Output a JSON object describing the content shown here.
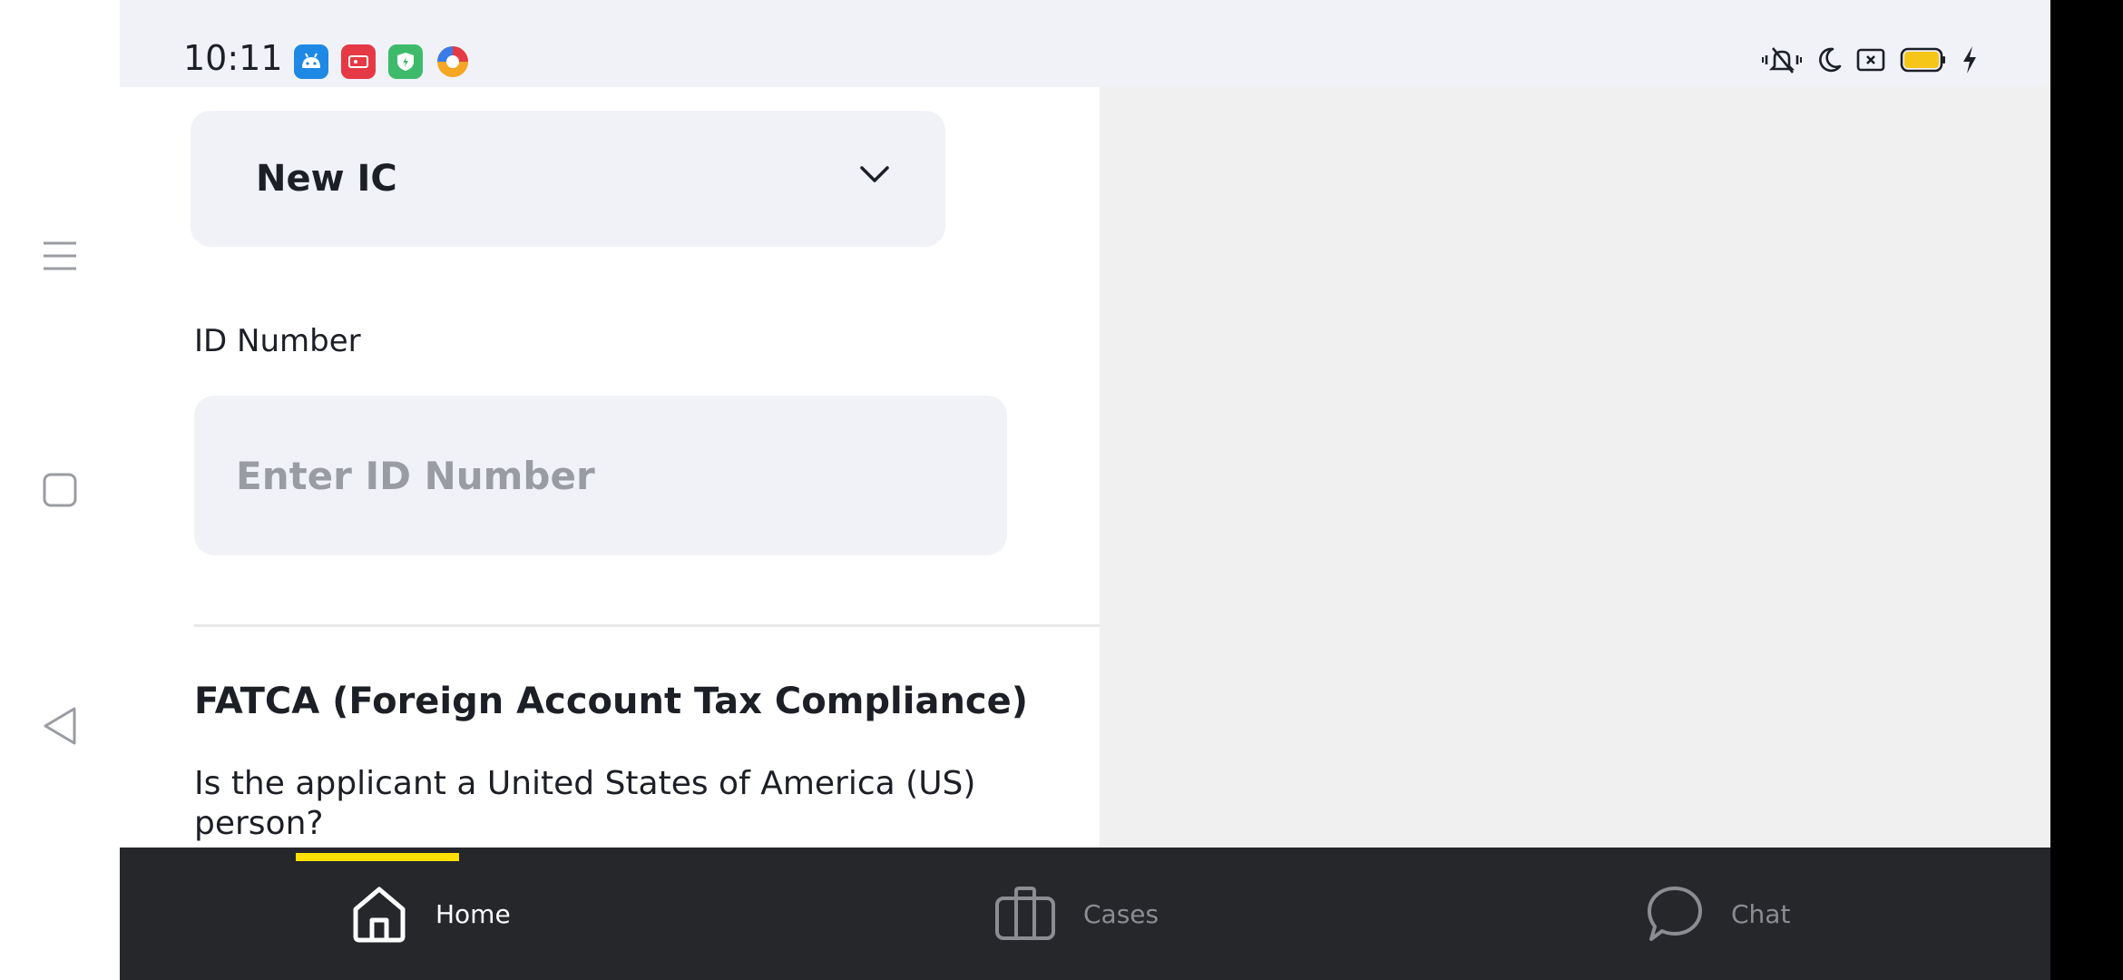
{
  "status_bar": {
    "time": "10:11",
    "notification_icons": [
      {
        "name": "android-app-icon",
        "color": "#1e88e5"
      },
      {
        "name": "screen-recorder-icon",
        "color": "#e53945"
      },
      {
        "name": "security-shield-icon",
        "color": "#3dbb6b"
      },
      {
        "name": "browser-app-icon",
        "color": "#f5a623"
      }
    ],
    "system_icons": [
      "vibrate-mute-icon",
      "do-not-disturb-moon-icon",
      "screen-cast-icon",
      "battery-icon",
      "charging-bolt-icon"
    ],
    "battery_color": "#f5c518"
  },
  "form": {
    "id_type": {
      "selected": "New IC"
    },
    "id_number": {
      "label": "ID Number",
      "placeholder": "Enter ID Number",
      "value": ""
    },
    "fatca": {
      "title": "FATCA (Foreign Account Tax Compliance)",
      "question": "Is the applicant a United States of America (US) person?"
    }
  },
  "bottom_nav": {
    "active": "home",
    "indicator_color": "#ffe100",
    "tabs": [
      {
        "id": "home",
        "label": "Home",
        "icon": "home-icon"
      },
      {
        "id": "cases",
        "label": "Cases",
        "icon": "briefcase-icon"
      },
      {
        "id": "chat",
        "label": "Chat",
        "icon": "chat-bubble-icon"
      }
    ]
  },
  "system_nav": {
    "buttons": [
      "menu-icon",
      "recents-square-icon",
      "back-triangle-icon"
    ]
  }
}
